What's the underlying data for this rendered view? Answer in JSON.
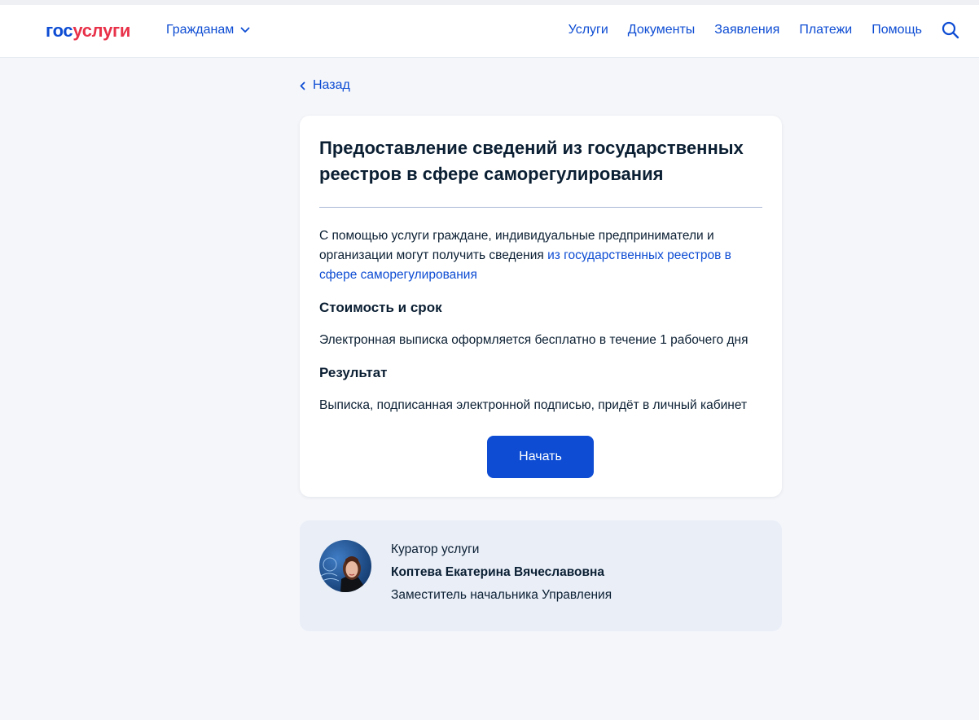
{
  "header": {
    "logo_part1": "гос",
    "logo_part2": "услуги",
    "citizens_label": "Гражданам",
    "nav": [
      "Услуги",
      "Документы",
      "Заявления",
      "Платежи",
      "Помощь"
    ],
    "search_icon": "search-icon"
  },
  "back_label": "Назад",
  "service": {
    "title": "Предоставление сведений из государственных реестров в сфере саморегулирования",
    "description_text": "С помощью услуги граждане, индивидуальные предприниматели и организации могут получить сведения ",
    "description_link": "из государственных реестров в сфере саморегулирования",
    "cost_heading": "Стоимость и срок",
    "cost_text": "Электронная выписка оформляется бесплатно в течение 1 рабочего дня",
    "result_heading": "Результат",
    "result_text": "Выписка, подписанная электронной подписью, придёт в личный кабинет",
    "start_button": "Начать"
  },
  "curator": {
    "label": "Куратор услуги",
    "name": "Коптева Екатерина Вячеславовна",
    "position": "Заместитель начальника Управления"
  },
  "colors": {
    "primary": "#0d4cd3",
    "logo_red": "#e8324a",
    "text": "#0b1f33",
    "page_bg": "#f4f6fa",
    "curator_bg": "#e9eef7"
  }
}
